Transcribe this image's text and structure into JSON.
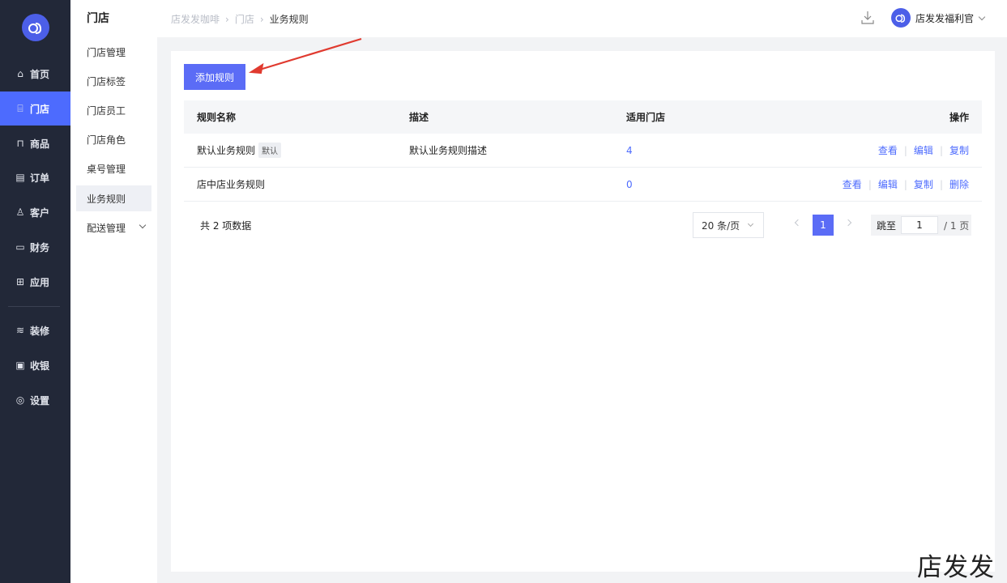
{
  "nav": {
    "items": [
      {
        "label": "首页",
        "icon": "home-icon"
      },
      {
        "label": "门店",
        "icon": "store-icon"
      },
      {
        "label": "商品",
        "icon": "bag-icon"
      },
      {
        "label": "订单",
        "icon": "order-icon"
      },
      {
        "label": "客户",
        "icon": "user-icon"
      },
      {
        "label": "财务",
        "icon": "card-icon"
      },
      {
        "label": "应用",
        "icon": "apps-icon"
      },
      {
        "label": "装修",
        "icon": "layers-icon"
      },
      {
        "label": "收银",
        "icon": "cashier-icon"
      },
      {
        "label": "设置",
        "icon": "settings-icon"
      }
    ],
    "active_color": "#4d6bfe"
  },
  "submenu": {
    "title": "门店",
    "items": [
      {
        "label": "门店管理"
      },
      {
        "label": "门店标签"
      },
      {
        "label": "门店员工"
      },
      {
        "label": "门店角色"
      },
      {
        "label": "桌号管理"
      },
      {
        "label": "业务规则"
      },
      {
        "label": "配送管理"
      }
    ]
  },
  "header": {
    "breadcrumb": [
      "店发发咖啡",
      "门店",
      "业务规则"
    ],
    "user_name": "店发发福利官"
  },
  "toolbar": {
    "add_label": "添加规则"
  },
  "table": {
    "columns": [
      "规则名称",
      "描述",
      "适用门店",
      "操作"
    ],
    "rows": [
      {
        "name": "默认业务规则",
        "tag": "默认",
        "desc": "默认业务规则描述",
        "stores": "4",
        "actions": [
          "查看",
          "编辑",
          "复制"
        ]
      },
      {
        "name": "店中店业务规则",
        "tag": "",
        "desc": "",
        "stores": "0",
        "actions": [
          "查看",
          "编辑",
          "复制",
          "删除"
        ]
      }
    ]
  },
  "pagination": {
    "total_text": "共 2 项数据",
    "page_size": "20 条/页",
    "current_page": "1",
    "jump_label": "跳至",
    "jump_value": "1",
    "total_pages": "/ 1 页"
  },
  "watermark": "店发发"
}
